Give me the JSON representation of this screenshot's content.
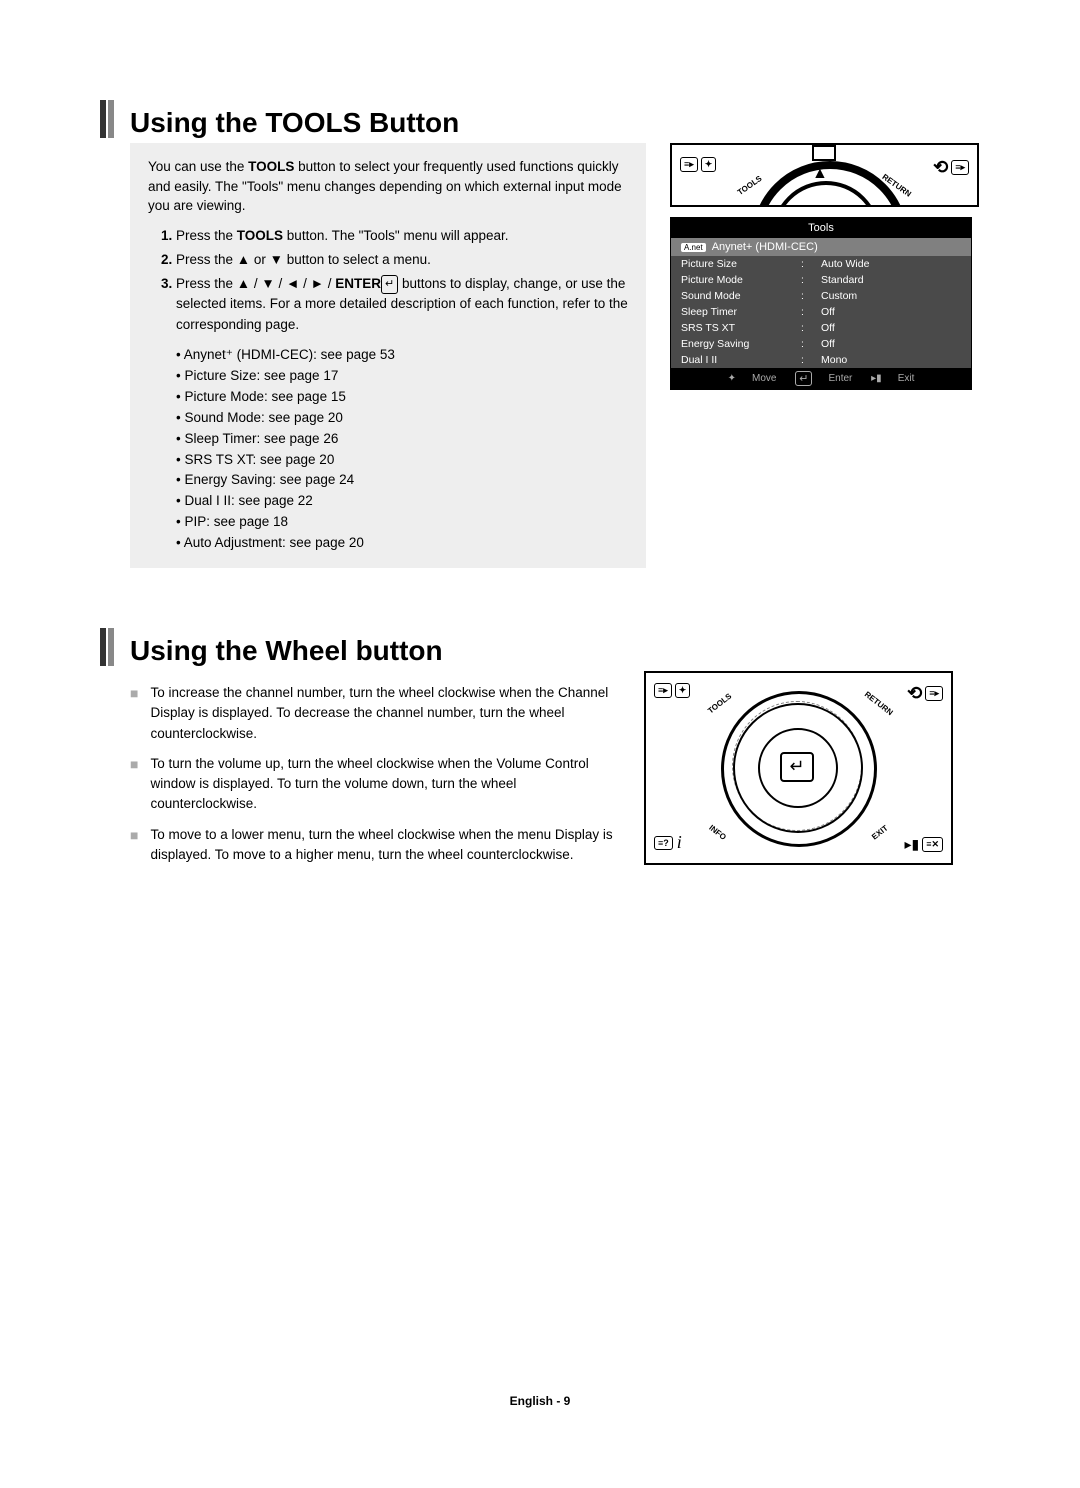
{
  "section1": {
    "title": "Using the TOOLS Button",
    "intro_pre": "You can use the ",
    "intro_bold": "TOOLS",
    "intro_post": " button to select your frequently used functions quickly and easily. The \"Tools\" menu changes depending on which external input mode you are viewing.",
    "step1_pre": "Press the ",
    "step1_bold": "TOOLS",
    "step1_post": " button. The \"Tools\" menu will appear.",
    "step2": "Press the ▲ or ▼ button to select a menu.",
    "step3_pre": "Press the ▲ / ▼ / ◄ / ► / ",
    "step3_bold": "ENTER",
    "step3_glyph": "↵",
    "step3_post": " buttons to display, change, or use the selected items. For a more detailed description of each function, refer to the corresponding page.",
    "bullets": [
      "Anynet⁺ (HDMI-CEC): see page 53",
      "Picture Size: see page 17",
      "Picture Mode: see page 15",
      "Sound Mode: see page 20",
      "Sleep Timer: see page 26",
      "SRS TS XT: see page 20",
      "Energy Saving: see page 24",
      "Dual I II: see page 22",
      "PIP: see page 18",
      "Auto Adjustment: see page 20"
    ],
    "remote": {
      "tools_label": "TOOLS",
      "return_label": "RETURN"
    },
    "tools_menu": {
      "title": "Tools",
      "highlight_pill": "A.net",
      "highlight_text": "Anynet+ (HDMI-CEC)",
      "rows": [
        {
          "label": "Picture Size",
          "value": "Auto Wide"
        },
        {
          "label": "Picture Mode",
          "value": "Standard"
        },
        {
          "label": "Sound Mode",
          "value": "Custom"
        },
        {
          "label": "Sleep Timer",
          "value": "Off"
        },
        {
          "label": "SRS TS XT",
          "value": "Off"
        },
        {
          "label": "Energy Saving",
          "value": "Off"
        },
        {
          "label": "Dual I II",
          "value": "Mono"
        }
      ],
      "nav_move": "Move",
      "nav_enter": "Enter",
      "nav_exit": "Exit"
    }
  },
  "section2": {
    "title": "Using the Wheel button",
    "items": [
      "To increase the channel number, turn the wheel clockwise when the Channel Display is displayed. To decrease the channel number, turn the wheel counterclockwise.",
      "To turn the volume up, turn the wheel clockwise when the Volume Control window is displayed. To turn the volume down, turn the wheel counterclockwise.",
      "To move to a lower menu, turn the wheel clockwise when the menu Display is displayed. To move to a higher menu, turn the wheel counterclockwise."
    ],
    "remote": {
      "tools_label": "TOOLS",
      "return_label": "RETURN",
      "info_label": "INFO",
      "exit_label": "EXIT",
      "info_i": "i"
    }
  },
  "footer": "English - 9"
}
